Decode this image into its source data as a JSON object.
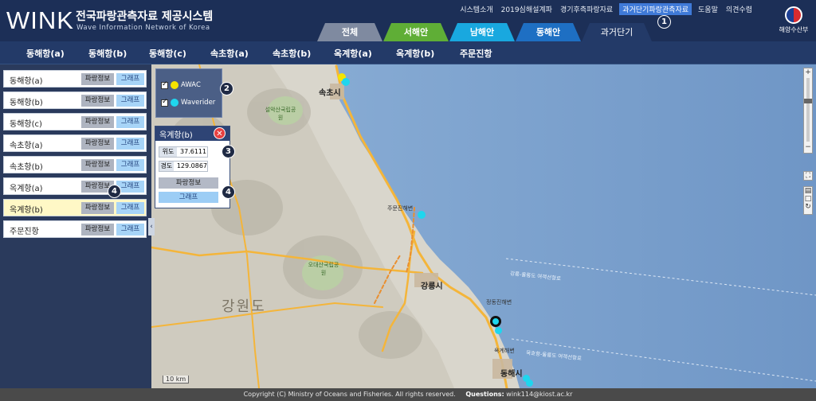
{
  "header": {
    "logo": "WINK",
    "title_kr": "전국파랑관측자료 제공시스템",
    "title_en": "Wave Information Network of Korea",
    "top_links": [
      "시스템소개",
      "2019심해설계파",
      "경기후측파랑자료",
      "과거단기파랑관측자료",
      "도움말",
      "의견수렴"
    ],
    "active_link": "과거단기파랑관측자료",
    "ministry": "해양수산부",
    "tabs": [
      "전체",
      "서해안",
      "남해안",
      "동해안",
      "과거단기자료"
    ]
  },
  "nav": [
    "동해항(a)",
    "동해항(b)",
    "동해항(c)",
    "속초항(a)",
    "속초항(b)",
    "옥계항(a)",
    "옥계항(b)",
    "주문진항"
  ],
  "sidebar": {
    "stations": [
      {
        "name": "동해항(a)"
      },
      {
        "name": "동해항(b)"
      },
      {
        "name": "동해항(c)"
      },
      {
        "name": "속초항(a)"
      },
      {
        "name": "속초항(b)"
      },
      {
        "name": "옥계항(a)"
      },
      {
        "name": "옥계항(b)",
        "selected": true
      },
      {
        "name": "주문진항"
      }
    ],
    "wave_btn": "파랑정보",
    "graph_btn": "그래프",
    "collapse": "‹"
  },
  "map": {
    "legend": [
      {
        "label": "AWAC",
        "color": "#f5e400"
      },
      {
        "label": "Waverider",
        "color": "#1fd6ee"
      }
    ],
    "popup": {
      "title": "옥계항(b)",
      "lat_label": "위도",
      "lat": "37.6111",
      "lon_label": "경도",
      "lon": "129.0867",
      "wave_btn": "파랑정보",
      "graph_btn": "그래프"
    },
    "callouts": [
      "1",
      "2",
      "3",
      "4"
    ],
    "labels": {
      "region": "강원도",
      "sokcho": "속초시",
      "gangneung": "강릉시",
      "donghae": "동해시",
      "seorak": "설악산국립공원",
      "odae": "오대산국립공원",
      "jeongdong": "정동진해변",
      "jumunjin": "주문진해변",
      "okgye": "옥계해변",
      "route": "강릉-울릉도 여객선항로",
      "route2": "묵호항-울릉도 여객선항로",
      "scale": "10 km"
    },
    "zoom": [
      "+",
      "−"
    ]
  },
  "footer": {
    "copyright": "Copyright (C) Ministry of Oceans and Fisheries. All rights reserved.",
    "questions_label": "Questions:",
    "email": "wink114@kiost.ac.kr"
  }
}
